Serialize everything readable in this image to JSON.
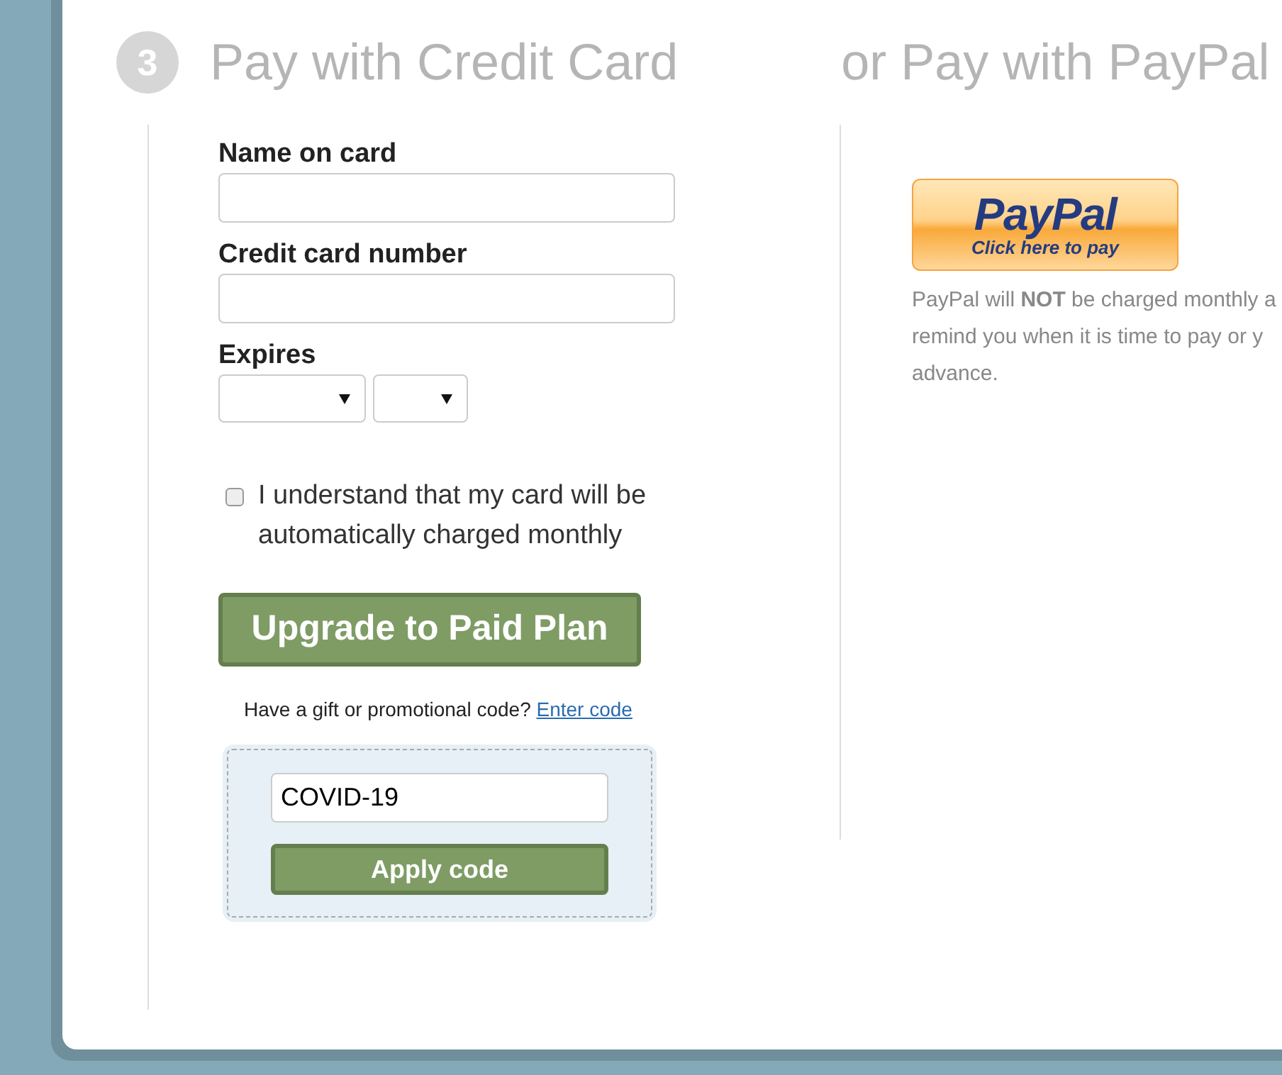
{
  "step": {
    "number": "3",
    "title": "Pay with Credit Card"
  },
  "alt_title": "or Pay with PayPal",
  "fields": [
    {
      "kind": "text",
      "label": "Name on card"
    },
    {
      "kind": "text",
      "label": "Credit card number"
    },
    {
      "kind": "expiry",
      "label": "Expires"
    }
  ],
  "agreement": {
    "label": "I understand that my card will be automatically charged monthly",
    "checked": false
  },
  "upgrade_button": "Upgrade to Paid Plan",
  "promo": {
    "prompt": "Have a gift or promotional code?",
    "link": "Enter code",
    "expanded": true,
    "value": "COVID-19",
    "button": "Apply code"
  },
  "paypal": {
    "logo": "PayPal",
    "caption": "Click here to pay",
    "note_lines": [
      "PayPal will **NOT** be charged monthly a",
      "remind you when it is time to pay or y",
      "advance."
    ]
  }
}
